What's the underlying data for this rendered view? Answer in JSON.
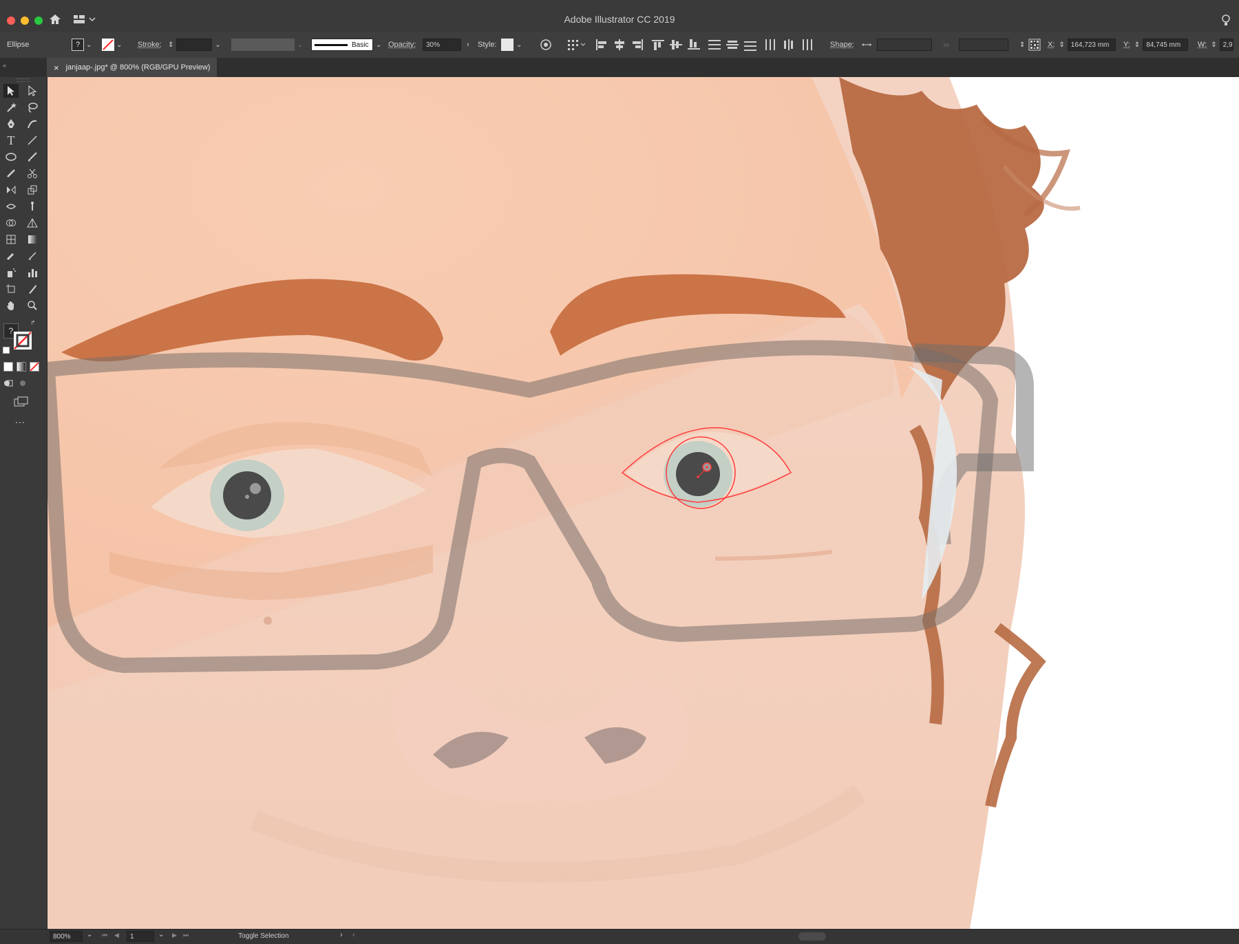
{
  "window": {
    "title": "Adobe Illustrator CC 2019"
  },
  "control": {
    "object_type": "Ellipse",
    "stroke_label": "Stroke:",
    "brush_label": "Basic",
    "opacity_label": "Opacity:",
    "opacity_value": "30%",
    "style_label": "Style:",
    "shape_label": "Shape:",
    "x_label": "X:",
    "x_value": "164,723 mm",
    "y_label": "Y:",
    "y_value": "84,745 mm",
    "w_label": "W:",
    "w_value": "2,9"
  },
  "document_tab": {
    "label": "janjaap-.jpg* @ 800% (RGB/GPU Preview)",
    "close": "×"
  },
  "toolbar": {
    "more": "...",
    "question": "?"
  },
  "status": {
    "zoom": "800%",
    "artboard": "1",
    "mode": "Toggle Selection"
  },
  "colors": {
    "skin": "#f5c2a7",
    "brow": "#c56a3d",
    "iris": "#c4cfc6",
    "pupil": "#4a4a4a",
    "selection": "#ff3b3b",
    "close": "#ff5f57",
    "minimize": "#febc2e",
    "zoom": "#28c840"
  }
}
